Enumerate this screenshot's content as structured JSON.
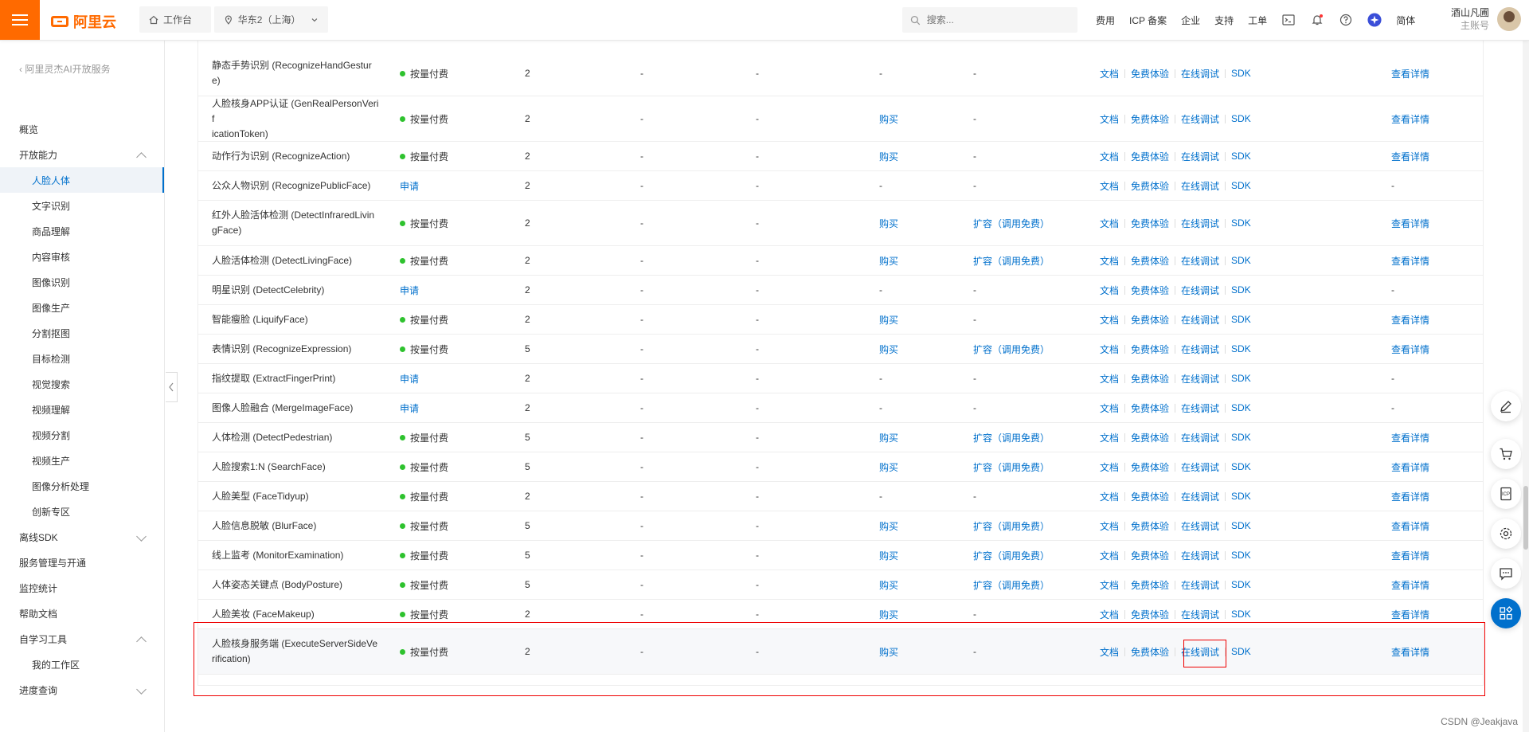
{
  "topbar": {
    "logo_text": "阿里云",
    "workbench": "工作台",
    "region": "华东2（上海）",
    "search_placeholder": "搜索...",
    "links": [
      "费用",
      "ICP 备案",
      "企业",
      "支持",
      "工单"
    ],
    "lang": "简体",
    "user_name": "酒山凡圃",
    "user_sub": "主账号"
  },
  "sidebar": {
    "back": "阿里灵杰AI开放服务",
    "items": [
      {
        "label": "概览",
        "level": 1
      },
      {
        "label": "开放能力",
        "level": 1,
        "chevron": "up"
      },
      {
        "label": "人脸人体",
        "level": 2,
        "active": true
      },
      {
        "label": "文字识别",
        "level": 2
      },
      {
        "label": "商品理解",
        "level": 2
      },
      {
        "label": "内容审核",
        "level": 2
      },
      {
        "label": "图像识别",
        "level": 2
      },
      {
        "label": "图像生产",
        "level": 2
      },
      {
        "label": "分割抠图",
        "level": 2
      },
      {
        "label": "目标检测",
        "level": 2
      },
      {
        "label": "视觉搜索",
        "level": 2
      },
      {
        "label": "视频理解",
        "level": 2
      },
      {
        "label": "视频分割",
        "level": 2
      },
      {
        "label": "视频生产",
        "level": 2
      },
      {
        "label": "图像分析处理",
        "level": 2
      },
      {
        "label": "创新专区",
        "level": 2
      },
      {
        "label": "离线SDK",
        "level": 1,
        "chevron": "down"
      },
      {
        "label": "服务管理与开通",
        "level": 1
      },
      {
        "label": "监控统计",
        "level": 1
      },
      {
        "label": "帮助文档",
        "level": 1
      },
      {
        "label": "自学习工具",
        "level": 1,
        "chevron": "up"
      },
      {
        "label": "我的工作区",
        "level": 2
      },
      {
        "label": "进度查询",
        "level": 1,
        "chevron": "down"
      }
    ]
  },
  "ops_labels": {
    "doc": "文档",
    "trial": "免费体验",
    "debug": "在线调试",
    "sdk": "SDK",
    "detail": "查看详情",
    "buy": "购买",
    "expand": "扩容（调用免费）",
    "apply": "申请",
    "paid": "按量付费",
    "dash": "-"
  },
  "rows": [
    {
      "name": [
        "静态手势识别 (RecognizeHandGestur",
        "e)"
      ],
      "status": "paid",
      "qps": "2",
      "c4": "-",
      "c5": "-",
      "buy": false,
      "expand": false,
      "detail": true
    },
    {
      "name": [
        "人脸核身APP认证 (GenRealPersonVerif",
        "icationToken)"
      ],
      "status": "paid",
      "qps": "2",
      "c4": "-",
      "c5": "-",
      "buy": true,
      "expand": false,
      "detail": true
    },
    {
      "name": [
        "动作行为识别 (RecognizeAction)"
      ],
      "status": "paid",
      "qps": "2",
      "c4": "-",
      "c5": "-",
      "buy": true,
      "expand": false,
      "detail": true
    },
    {
      "name": [
        "公众人物识别 (RecognizePublicFace)"
      ],
      "status": "apply",
      "qps": "2",
      "c4": "-",
      "c5": "-",
      "buy": false,
      "expand": false,
      "detail": false
    },
    {
      "name": [
        "红外人脸活体检测 (DetectInfraredLivin",
        "gFace)"
      ],
      "status": "paid",
      "qps": "2",
      "c4": "-",
      "c5": "-",
      "buy": true,
      "expand": true,
      "detail": true
    },
    {
      "name": [
        "人脸活体检测 (DetectLivingFace)"
      ],
      "status": "paid",
      "qps": "2",
      "c4": "-",
      "c5": "-",
      "buy": true,
      "expand": true,
      "detail": true
    },
    {
      "name": [
        "明星识别 (DetectCelebrity)"
      ],
      "status": "apply",
      "qps": "2",
      "c4": "-",
      "c5": "-",
      "buy": false,
      "expand": false,
      "detail": false
    },
    {
      "name": [
        "智能瘦脸 (LiquifyFace)"
      ],
      "status": "paid",
      "qps": "2",
      "c4": "-",
      "c5": "-",
      "buy": true,
      "expand": false,
      "detail": true
    },
    {
      "name": [
        "表情识别 (RecognizeExpression)"
      ],
      "status": "paid",
      "qps": "5",
      "c4": "-",
      "c5": "-",
      "buy": true,
      "expand": true,
      "detail": true
    },
    {
      "name": [
        "指纹提取 (ExtractFingerPrint)"
      ],
      "status": "apply",
      "qps": "2",
      "c4": "-",
      "c5": "-",
      "buy": false,
      "expand": false,
      "detail": false
    },
    {
      "name": [
        "图像人脸融合 (MergeImageFace)"
      ],
      "status": "apply",
      "qps": "2",
      "c4": "-",
      "c5": "-",
      "buy": false,
      "expand": false,
      "detail": false
    },
    {
      "name": [
        "人体检测 (DetectPedestrian)"
      ],
      "status": "paid",
      "qps": "5",
      "c4": "-",
      "c5": "-",
      "buy": true,
      "expand": true,
      "detail": true
    },
    {
      "name": [
        "人脸搜索1:N (SearchFace)"
      ],
      "status": "paid",
      "qps": "5",
      "c4": "-",
      "c5": "-",
      "buy": true,
      "expand": true,
      "detail": true
    },
    {
      "name": [
        "人脸美型 (FaceTidyup)"
      ],
      "status": "paid",
      "qps": "2",
      "c4": "-",
      "c5": "-",
      "buy": false,
      "expand": false,
      "detail": true
    },
    {
      "name": [
        "人脸信息脱敏 (BlurFace)"
      ],
      "status": "paid",
      "qps": "5",
      "c4": "-",
      "c5": "-",
      "buy": true,
      "expand": true,
      "detail": true
    },
    {
      "name": [
        "线上监考 (MonitorExamination)"
      ],
      "status": "paid",
      "qps": "5",
      "c4": "-",
      "c5": "-",
      "buy": true,
      "expand": true,
      "detail": true
    },
    {
      "name": [
        "人体姿态关键点 (BodyPosture)"
      ],
      "status": "paid",
      "qps": "5",
      "c4": "-",
      "c5": "-",
      "buy": true,
      "expand": true,
      "detail": true
    },
    {
      "name": [
        "人脸美妆 (FaceMakeup)"
      ],
      "status": "paid",
      "qps": "2",
      "c4": "-",
      "c5": "-",
      "buy": true,
      "expand": false,
      "detail": true
    },
    {
      "name": [
        "人脸核身服务端 (ExecuteServerSideVe",
        "rification)"
      ],
      "status": "paid",
      "qps": "2",
      "c4": "-",
      "c5": "-",
      "buy": true,
      "expand": false,
      "detail": true,
      "highlight": true
    }
  ],
  "watermark": "CSDN @Jeakjava",
  "colors": {
    "brand": "#ff6a00",
    "link": "#0070cc",
    "paid_dot": "#2ec22e",
    "annotation": "#e00000"
  }
}
